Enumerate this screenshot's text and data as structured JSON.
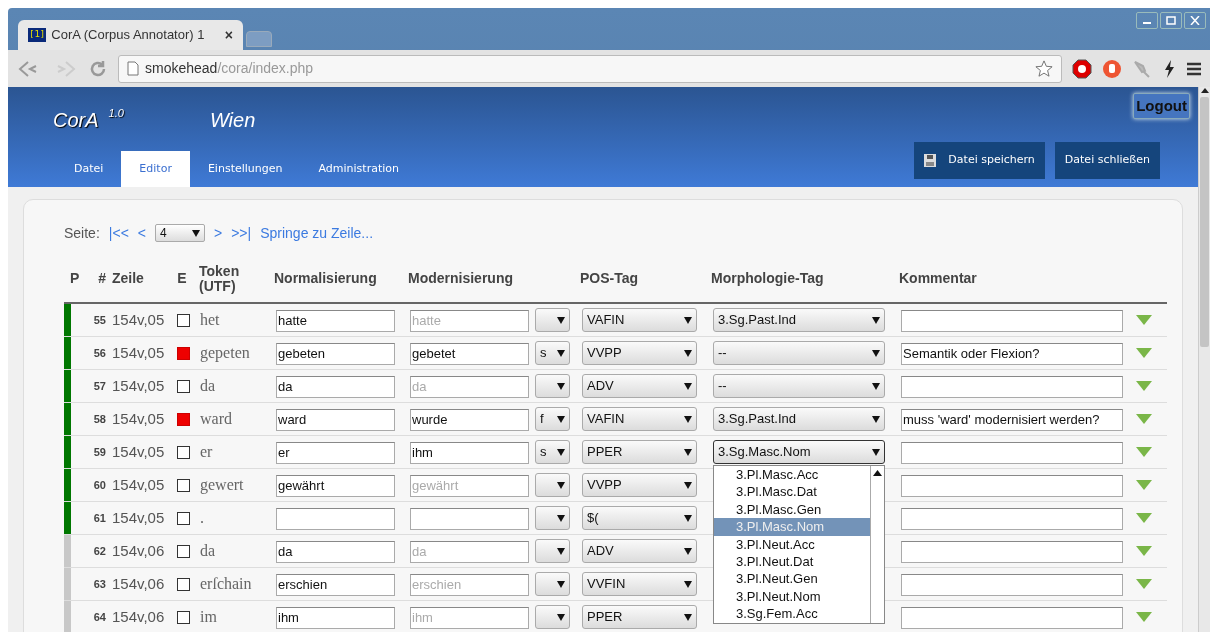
{
  "browser": {
    "favicon": "[1]",
    "tab_title": "CorA (Corpus Annotator) 1",
    "tab_close": "×",
    "address_host": "smokehead",
    "address_path": "/cora/index.php"
  },
  "app": {
    "name": "CorA",
    "version": "1.0",
    "file_title": "Wien",
    "logout": "Logout"
  },
  "nav_tabs": [
    {
      "label": "Datei",
      "selected": false
    },
    {
      "label": "Editor",
      "selected": true
    },
    {
      "label": "Einstellungen",
      "selected": false
    },
    {
      "label": "Administration",
      "selected": false
    }
  ],
  "actions": [
    {
      "label": "Datei speichern",
      "kind": "save"
    },
    {
      "label": "Datei schließen",
      "kind": "plain"
    }
  ],
  "pager": {
    "label": "Seite:",
    "first": "|<<",
    "prev": "<",
    "page": "4",
    "next": ">",
    "last": ">>|",
    "jump": "Springe zu Zeile..."
  },
  "columns": [
    "P",
    "#",
    "Zeile",
    "E",
    "Token (UTF)",
    "Normalisierung",
    "Modernisierung",
    "POS-Tag",
    "Morphologie-Tag",
    "Kommentar"
  ],
  "rows": [
    {
      "progress": true,
      "num": "55",
      "line": "154v,05",
      "error": false,
      "token": "het",
      "norm": "hatte",
      "mod": {
        "placeholder": "hatte"
      },
      "pos": "VAFIN",
      "morph": "3.Sg.Past.Ind"
    },
    {
      "progress": true,
      "num": "56",
      "line": "154v,05",
      "error": true,
      "token": "gepeten",
      "norm": "gebeten",
      "mod": {
        "value": "gebetet"
      },
      "mod_type": "s",
      "pos": "VVPP",
      "morph": "--",
      "comment": "Semantik oder Flexion?"
    },
    {
      "progress": true,
      "num": "57",
      "line": "154v,05",
      "error": false,
      "token": "da",
      "norm": "da",
      "mod": {
        "placeholder": "da"
      },
      "pos": "ADV",
      "morph": "--"
    },
    {
      "progress": true,
      "num": "58",
      "line": "154v,05",
      "error": true,
      "token": "ward",
      "norm": "ward",
      "mod": {
        "value": "wurde"
      },
      "mod_type": "f",
      "pos": "VAFIN",
      "morph": "3.Sg.Past.Ind",
      "comment": "muss 'ward' modernisiert werden?"
    },
    {
      "progress": true,
      "num": "59",
      "line": "154v,05",
      "error": false,
      "token": "er",
      "norm": "er",
      "mod": {
        "value": "ihm"
      },
      "mod_type": "s",
      "pos": "PPER",
      "morph": "3.Sg.Masc.Nom",
      "morph_menu": [
        {
          "label": "3.Pl.Masc.Acc",
          "selected": false
        },
        {
          "label": "3.Pl.Masc.Dat",
          "selected": false
        },
        {
          "label": "3.Pl.Masc.Gen",
          "selected": false
        },
        {
          "label": "3.Pl.Masc.Nom",
          "selected": true
        },
        {
          "label": "3.Pl.Neut.Acc",
          "selected": false
        },
        {
          "label": "3.Pl.Neut.Dat",
          "selected": false
        },
        {
          "label": "3.Pl.Neut.Gen",
          "selected": false
        },
        {
          "label": "3.Pl.Neut.Nom",
          "selected": false
        },
        {
          "label": "3.Sg.Fem.Acc",
          "selected": false
        }
      ]
    },
    {
      "progress": true,
      "num": "60",
      "line": "154v,05",
      "error": false,
      "token": "gewert",
      "norm": "gewährt",
      "mod": {
        "placeholder": "gewährt"
      },
      "pos": "VVPP"
    },
    {
      "progress": true,
      "num": "61",
      "line": "154v,05",
      "error": false,
      "token": ".",
      "mod": {},
      "pos": "$("
    },
    {
      "progress": false,
      "num": "62",
      "line": "154v,06",
      "error": false,
      "token": "da",
      "norm": "da",
      "mod": {
        "placeholder": "da"
      },
      "pos": "ADV"
    },
    {
      "progress": false,
      "num": "63",
      "line": "154v,06",
      "error": false,
      "token": "erſchain",
      "norm": "erschien",
      "mod": {
        "placeholder": "erschien"
      },
      "pos": "VVFIN"
    },
    {
      "progress": false,
      "num": "64",
      "line": "154v,06",
      "error": false,
      "token": "im",
      "norm": "ihm",
      "mod": {
        "placeholder": "ihm"
      },
      "pos": "PPER"
    }
  ]
}
